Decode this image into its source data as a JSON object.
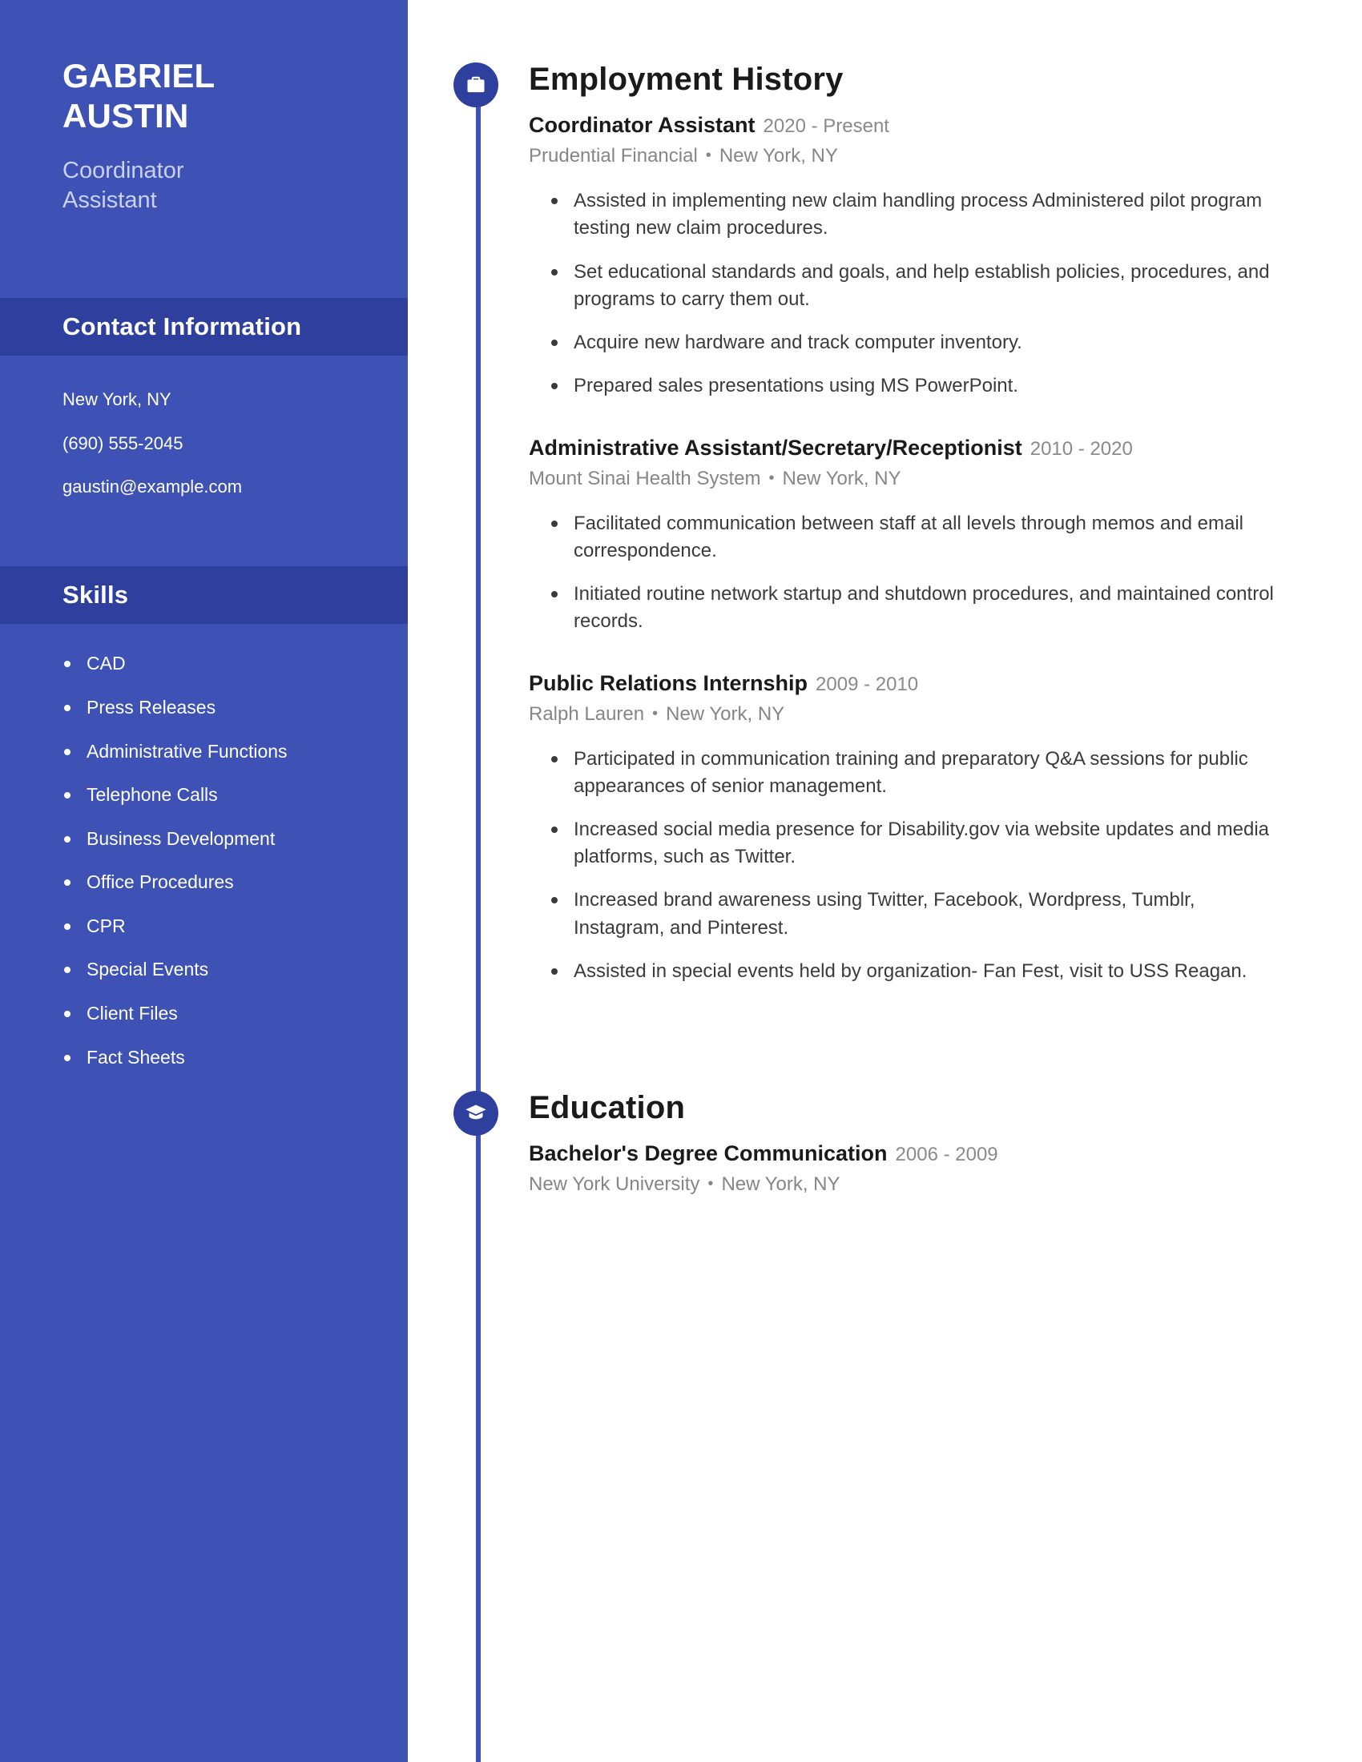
{
  "colors": {
    "sidebar_bg": "#3d52b4",
    "sidebar_band_bg": "#2e3f9e",
    "badge_bg": "#2e3f9e",
    "rail": "#3d52b4",
    "heading_text": "#1a1a1a",
    "body_text": "#3b3b3b",
    "muted_text": "#868686",
    "sidebar_subtitle": "#c9d1ef"
  },
  "sidebar": {
    "name_first": "GABRIEL",
    "name_last": "AUSTIN",
    "title_line1": "Coordinator",
    "title_line2": "Assistant",
    "contact_heading": "Contact Information",
    "contact": [
      "New York, NY",
      "(690) 555-2045",
      "gaustin@example.com"
    ],
    "skills_heading": "Skills",
    "skills": [
      "CAD",
      "Press Releases",
      "Administrative Functions",
      "Telephone Calls",
      "Business Development",
      "Office Procedures",
      "CPR",
      "Special Events",
      "Client Files",
      "Fact Sheets"
    ]
  },
  "main": {
    "employment": {
      "heading": "Employment History",
      "icon": "briefcase-icon",
      "entries": [
        {
          "role": "Coordinator Assistant",
          "dates": "2020 - Present",
          "company": "Prudential Financial",
          "location": "New York, NY",
          "bullets": [
            "Assisted in implementing new claim handling process Administered pilot program testing new claim procedures.",
            "Set educational standards and goals, and help establish policies, procedures, and programs to carry them out.",
            "Acquire new hardware and track computer inventory.",
            "Prepared sales presentations using MS PowerPoint."
          ]
        },
        {
          "role": "Administrative Assistant/Secretary/Receptionist",
          "dates": "2010 - 2020",
          "company": "Mount Sinai Health System",
          "location": "New York, NY",
          "bullets": [
            "Facilitated communication between staff at all levels through memos and email correspondence.",
            "Initiated routine network startup and shutdown procedures, and maintained control records."
          ]
        },
        {
          "role": "Public Relations Internship",
          "dates": "2009 - 2010",
          "company": "Ralph Lauren",
          "location": "New York, NY",
          "bullets": [
            "Participated in communication training and preparatory Q&A sessions for public appearances of senior management.",
            "Increased social media presence for Disability.gov via website updates and media platforms, such as Twitter.",
            "Increased brand awareness using Twitter, Facebook, Wordpress, Tumblr, Instagram, and Pinterest.",
            "Assisted in special events held by organization- Fan Fest, visit to USS Reagan."
          ]
        }
      ]
    },
    "education": {
      "heading": "Education",
      "icon": "graduation-cap-icon",
      "entries": [
        {
          "degree": "Bachelor's Degree Communication",
          "dates": "2006 - 2009",
          "school": "New York University",
          "location": "New York, NY"
        }
      ]
    }
  },
  "separator": "•"
}
